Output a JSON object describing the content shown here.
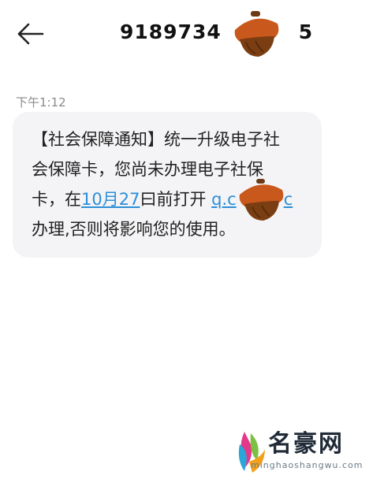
{
  "header": {
    "back_icon": "arrow-left-icon",
    "sender_number": "9189734",
    "sender_number_tail": "5"
  },
  "message": {
    "timestamp": "下午1:12",
    "line1": "【社会保障通知】统一升级电子社",
    "line2": "会保障卡，您尚未办理电子社保",
    "line3_prefix": "卡，在",
    "date_link": "10月27",
    "line3_mid": "曰前打开 ",
    "url_start": "q.c",
    "url_end": "c",
    "line4": "办理,否则将影响您的使用。"
  },
  "colors": {
    "bubble_bg": "#f4f4f6",
    "link": "#2c8ed8",
    "timestamp": "#8a8a8a",
    "acorn": "#8a4a1a"
  },
  "watermark": {
    "brand": "名豪网",
    "url": "minghaoshangwu.com"
  }
}
